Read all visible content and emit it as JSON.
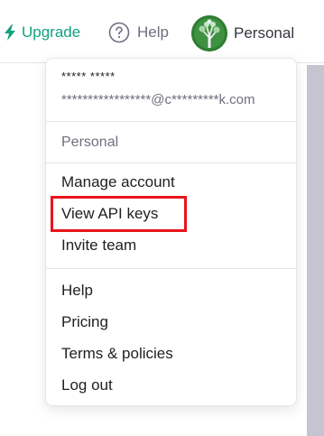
{
  "topbar": {
    "upgrade_label": "Upgrade",
    "help_label": "Help",
    "account_label": "Personal"
  },
  "menu": {
    "user_name": "***** *****",
    "user_email": "*****************@c*********k.com",
    "organization": "Personal",
    "account_items": [
      "Manage account",
      "View API keys",
      "Invite team"
    ],
    "nav_items": [
      "Help",
      "Pricing",
      "Terms & policies",
      "Log out"
    ]
  },
  "icons": {
    "upgrade": "lightning-bolt-icon",
    "help": "question-circle-icon",
    "avatar": "tree-avatar"
  },
  "colors": {
    "accent": "#10a37f",
    "highlight": "#e8141c",
    "text": "#202123",
    "muted": "#6e6e80"
  }
}
